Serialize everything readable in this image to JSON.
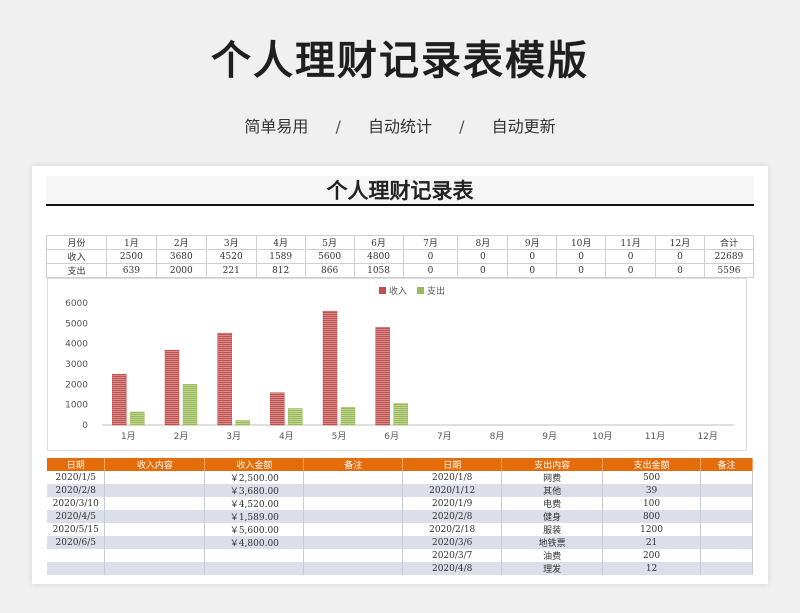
{
  "hero": {
    "title": "个人理财记录表模版",
    "tags": [
      "简单易用",
      "自动统计",
      "自动更新"
    ],
    "separator": "/"
  },
  "sheet": {
    "title": "个人理财记录表"
  },
  "summary": {
    "header": [
      "月份",
      "1月",
      "2月",
      "3月",
      "4月",
      "5月",
      "6月",
      "7月",
      "8月",
      "9月",
      "10月",
      "11月",
      "12月",
      "合计"
    ],
    "rows": [
      [
        "收入",
        "2500",
        "3680",
        "4520",
        "1589",
        "5600",
        "4800",
        "0",
        "0",
        "0",
        "0",
        "0",
        "0",
        "22689"
      ],
      [
        "支出",
        "639",
        "2000",
        "221",
        "812",
        "866",
        "1058",
        "0",
        "0",
        "0",
        "0",
        "0",
        "0",
        "5596"
      ]
    ]
  },
  "chart_data": {
    "type": "bar",
    "categories": [
      "1月",
      "2月",
      "3月",
      "4月",
      "5月",
      "6月",
      "7月",
      "8月",
      "9月",
      "10月",
      "11月",
      "12月"
    ],
    "series": [
      {
        "name": "收入",
        "color": "#c0504d",
        "values": [
          2500,
          3680,
          4520,
          1589,
          5600,
          4800,
          0,
          0,
          0,
          0,
          0,
          0
        ]
      },
      {
        "name": "支出",
        "color": "#9bbb59",
        "values": [
          639,
          2000,
          221,
          812,
          866,
          1058,
          0,
          0,
          0,
          0,
          0,
          0
        ]
      }
    ],
    "ylim": [
      0,
      6000
    ],
    "yticks": [
      0,
      1000,
      2000,
      3000,
      4000,
      5000,
      6000
    ],
    "legend": "top-center",
    "grid": false
  },
  "records": {
    "header": [
      "日期",
      "收入内容",
      "收入金额",
      "备注",
      "日期",
      "支出内容",
      "支出金额",
      "备注"
    ],
    "rows": [
      [
        "2020/1/5",
        "",
        "￥2,500.00",
        "",
        "2020/1/8",
        "网费",
        "500",
        ""
      ],
      [
        "2020/2/8",
        "",
        "￥3,680.00",
        "",
        "2020/1/12",
        "其他",
        "39",
        ""
      ],
      [
        "2020/3/10",
        "",
        "￥4,520.00",
        "",
        "2020/1/9",
        "电费",
        "100",
        ""
      ],
      [
        "2020/4/5",
        "",
        "￥1,589.00",
        "",
        "2020/2/8",
        "健身",
        "800",
        ""
      ],
      [
        "2020/5/15",
        "",
        "￥5,600.00",
        "",
        "2020/2/18",
        "服装",
        "1200",
        ""
      ],
      [
        "2020/6/5",
        "",
        "￥4,800.00",
        "",
        "2020/3/6",
        "地铁票",
        "21",
        ""
      ],
      [
        "",
        "",
        "",
        "",
        "2020/3/7",
        "油费",
        "200",
        ""
      ],
      [
        "",
        "",
        "",
        "",
        "2020/4/8",
        "理发",
        "12",
        ""
      ]
    ]
  }
}
